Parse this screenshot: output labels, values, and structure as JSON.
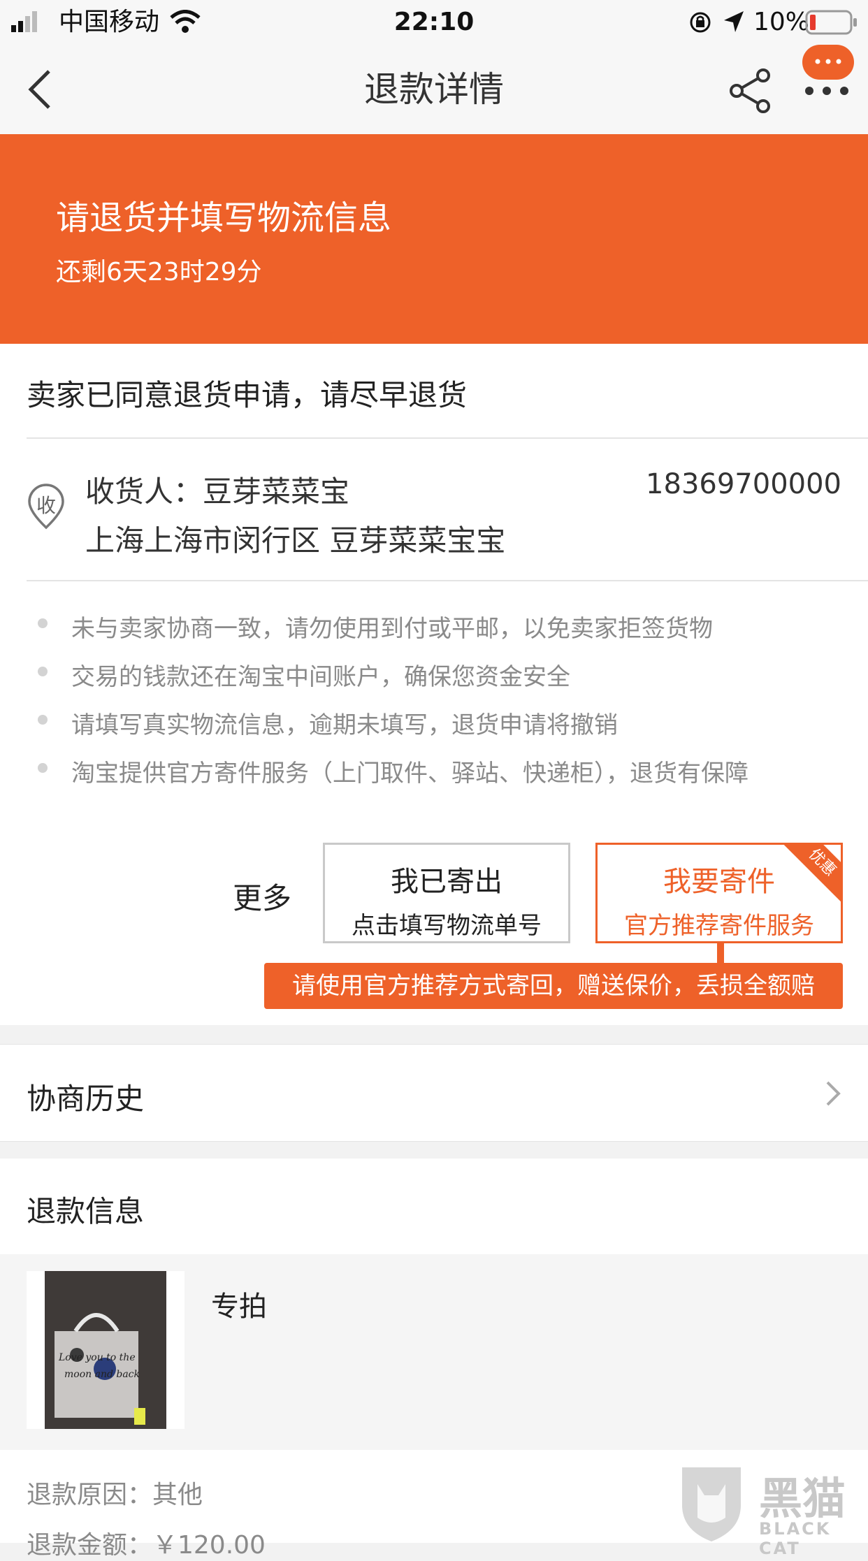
{
  "status_bar": {
    "carrier": "中国移动",
    "time": "22:10",
    "battery": "10%"
  },
  "nav": {
    "title": "退款详情"
  },
  "banner": {
    "title": "请退货并填写物流信息",
    "countdown": "还剩6天23时29分"
  },
  "notice": "卖家已同意退货申请，请尽早退货",
  "address": {
    "badge": "收",
    "name_line": "收货人：豆芽菜菜宝",
    "phone": "18369700000",
    "address_line": "上海上海市闵行区 豆芽菜菜宝宝"
  },
  "tips": [
    "未与卖家协商一致，请勿使用到付或平邮，以免卖家拒签货物",
    "交易的钱款还在淘宝中间账户，确保您资金安全",
    "请填写真实物流信息，逾期未填写，退货申请将撤销",
    "淘宝提供官方寄件服务（上门取件、驿站、快递柜），退货有保障"
  ],
  "actions": {
    "more_label": "更多",
    "shipped_title": "我已寄出",
    "shipped_sub": "点击填写物流单号",
    "send_title": "我要寄件",
    "send_sub": "官方推荐寄件服务",
    "promo_tag": "优惠",
    "tooltip": "请使用官方推荐方式寄回，赠送保价，丢损全额赔"
  },
  "history": {
    "label": "协商历史"
  },
  "refund": {
    "title": "退款信息",
    "product_name": "专拍",
    "thumb_caption_line1": "Love you to the",
    "thumb_caption_line2": "moon and back",
    "reason": "退款原因：其他",
    "amount": "退款金额：￥120.00"
  },
  "watermark": {
    "brand_cn": "黑猫",
    "brand_en": "BLACK CAT"
  },
  "colors": {
    "accent": "#ee6129",
    "background": "#f2f2f2",
    "tip_text": "#8a8a8a"
  }
}
